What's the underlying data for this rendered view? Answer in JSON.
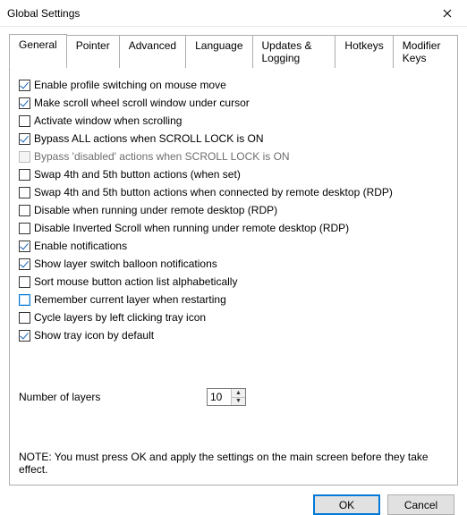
{
  "window": {
    "title": "Global Settings"
  },
  "tabs": [
    {
      "label": "General"
    },
    {
      "label": "Pointer"
    },
    {
      "label": "Advanced"
    },
    {
      "label": "Language"
    },
    {
      "label": "Updates & Logging"
    },
    {
      "label": "Hotkeys"
    },
    {
      "label": "Modifier Keys"
    }
  ],
  "options": [
    {
      "label": "Enable profile switching on mouse move",
      "checked": true
    },
    {
      "label": "Make scroll wheel scroll window under cursor",
      "checked": true
    },
    {
      "label": "Activate window when scrolling",
      "checked": false
    },
    {
      "label": "Bypass ALL actions when SCROLL LOCK is ON",
      "checked": true
    },
    {
      "label": "Bypass 'disabled' actions when SCROLL LOCK is ON",
      "checked": false,
      "disabled": true
    },
    {
      "label": "Swap 4th and 5th button actions (when set)",
      "checked": false
    },
    {
      "label": "Swap 4th and 5th button actions when connected by remote desktop (RDP)",
      "checked": false
    },
    {
      "label": "Disable when running under remote desktop (RDP)",
      "checked": false
    },
    {
      "label": "Disable Inverted Scroll when running under remote desktop (RDP)",
      "checked": false
    },
    {
      "label": "Enable notifications",
      "checked": true
    },
    {
      "label": "Show layer switch balloon notifications",
      "checked": true
    },
    {
      "label": "Sort mouse button action list alphabetically",
      "checked": false
    },
    {
      "label": "Remember current layer when restarting",
      "checked": false,
      "highlight": true
    },
    {
      "label": "Cycle layers by left clicking tray icon",
      "checked": false
    },
    {
      "label": "Show tray icon by default",
      "checked": true
    }
  ],
  "layers": {
    "label": "Number of layers",
    "value": "10"
  },
  "note": "NOTE: You must press OK and apply the settings on the main screen before they take effect.",
  "buttons": {
    "ok": "OK",
    "cancel": "Cancel"
  }
}
